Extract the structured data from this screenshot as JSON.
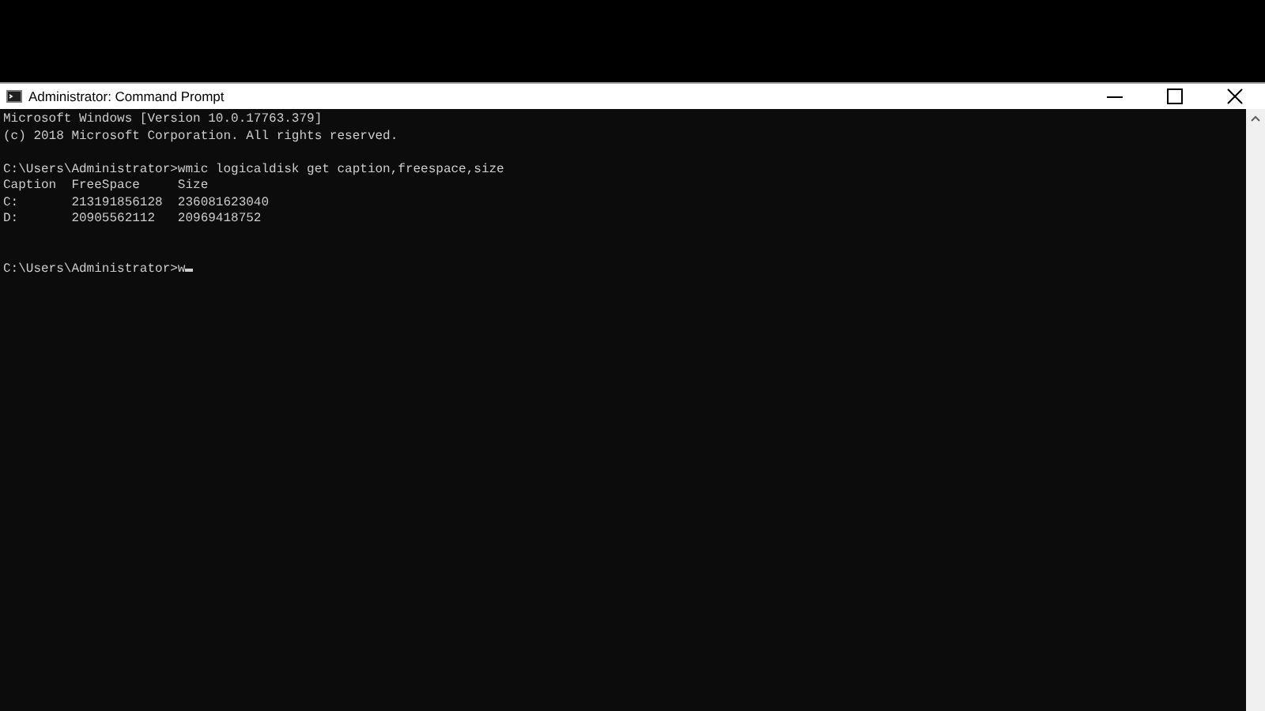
{
  "window": {
    "title": "Administrator: Command Prompt"
  },
  "console": {
    "blocks": [
      [
        "Microsoft Windows [Version 10.0.17763.379]",
        "(c) 2018 Microsoft Corporation. All rights reserved."
      ],
      [
        "C:\\Users\\Administrator>wmic logicaldisk get caption,freespace,size",
        "Caption  FreeSpace     Size",
        "C:       213191856128  236081623040",
        "D:       20905562112   20969418752"
      ],
      [
        "C:\\Users\\Administrator>w"
      ]
    ],
    "cursor": true
  }
}
